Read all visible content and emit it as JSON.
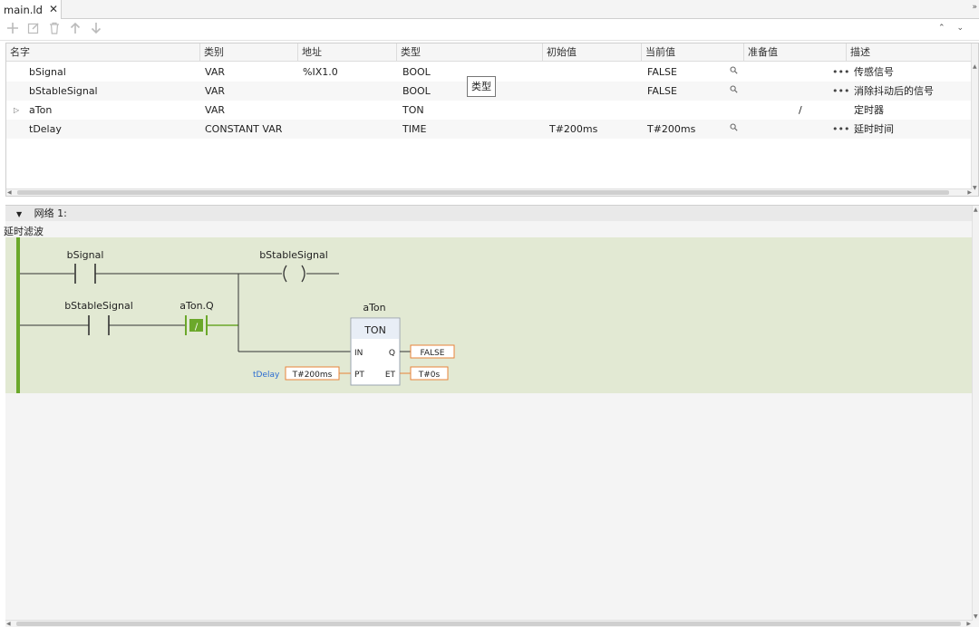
{
  "tab": {
    "label": "main.ld",
    "close_glyph": "✕"
  },
  "toolbar": {
    "icons": [
      "add-icon",
      "edit-icon",
      "delete-icon",
      "move-up-icon",
      "move-down-icon"
    ],
    "collapse_glyphs": "⌃ ⌄"
  },
  "table": {
    "columns": [
      "名字",
      "类别",
      "地址",
      "类型",
      "初始值",
      "当前值",
      "准备值",
      "描述"
    ],
    "rows": [
      {
        "name": "bSignal",
        "class": "VAR",
        "address": "%IX1.0",
        "type": "BOOL",
        "initial": "",
        "current": "FALSE",
        "prepared": "",
        "desc": "传感信号",
        "has_search": true,
        "has_dots": true
      },
      {
        "name": "bStableSignal",
        "class": "VAR",
        "address": "",
        "type": "BOOL",
        "initial": "",
        "current": "FALSE",
        "prepared": "",
        "desc": "消除抖动后的信号",
        "has_search": true,
        "has_dots": true
      },
      {
        "name": "aTon",
        "class": "VAR",
        "address": "",
        "type": "TON",
        "initial": "",
        "current": "",
        "prepared": "/",
        "desc": "定时器",
        "has_search": false,
        "has_dots": false
      },
      {
        "name": "tDelay",
        "class": "CONSTANT VAR",
        "address": "",
        "type": "TIME",
        "initial": "T#200ms",
        "current": "T#200ms",
        "prepared": "",
        "desc": "延时时间",
        "has_search": true,
        "has_dots": true
      }
    ],
    "tooltip": "类型",
    "dots": "•••",
    "search_glyph": "⚲"
  },
  "network": {
    "header": "网络 1:",
    "comment": "延时滤波",
    "rung": {
      "contact1": "bSignal",
      "coil": "bStableSignal",
      "contact2": "bStableSignal",
      "contact3": "aTon.Q",
      "contact3_mark": "/",
      "fb_instance": "aTon",
      "fb_type": "TON",
      "pin_in": "IN",
      "pin_q": "Q",
      "pin_pt": "PT",
      "pin_et": "ET",
      "q_value": "FALSE",
      "pt_var": "tDelay",
      "pt_value": "T#200ms",
      "et_value": "T#0s"
    }
  },
  "colors": {
    "rung_bg": "#e2e9d3",
    "power_rail": "#6ba82a",
    "value_border": "#e8833a",
    "fb_head": "#e8eef6",
    "var_link": "#2a6bd1"
  }
}
